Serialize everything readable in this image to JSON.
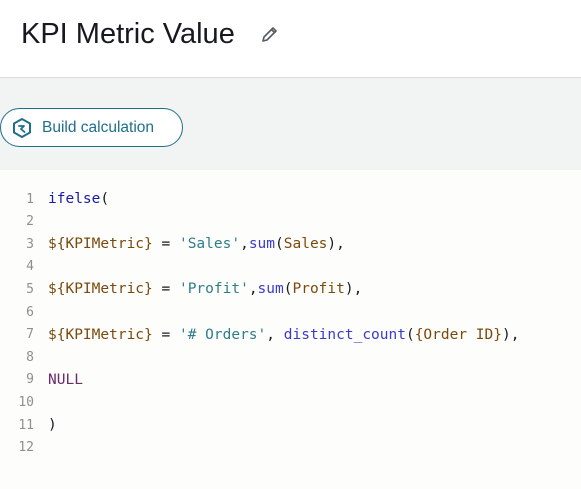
{
  "header": {
    "title": "KPI Metric Value",
    "edit_icon": "pencil-icon"
  },
  "toolbar": {
    "build_label": "Build calculation",
    "build_icon": "calculation-icon"
  },
  "editor": {
    "lines": [
      {
        "num": "1",
        "tokens": [
          {
            "t": "ifelse",
            "c": "kw"
          },
          {
            "t": "(",
            "c": "op"
          }
        ]
      },
      {
        "num": "2",
        "tokens": []
      },
      {
        "num": "3",
        "tokens": [
          {
            "t": "${KPIMetric}",
            "c": "field"
          },
          {
            "t": " = ",
            "c": "op"
          },
          {
            "t": "'Sales'",
            "c": "str"
          },
          {
            "t": ",",
            "c": "op"
          },
          {
            "t": "sum",
            "c": "fn"
          },
          {
            "t": "(",
            "c": "op"
          },
          {
            "t": "Sales",
            "c": "field"
          },
          {
            "t": "),",
            "c": "op"
          }
        ]
      },
      {
        "num": "4",
        "tokens": []
      },
      {
        "num": "5",
        "tokens": [
          {
            "t": "${KPIMetric}",
            "c": "field"
          },
          {
            "t": " = ",
            "c": "op"
          },
          {
            "t": "'Profit'",
            "c": "str"
          },
          {
            "t": ",",
            "c": "op"
          },
          {
            "t": "sum",
            "c": "fn"
          },
          {
            "t": "(",
            "c": "op"
          },
          {
            "t": "Profit",
            "c": "field"
          },
          {
            "t": "),",
            "c": "op"
          }
        ]
      },
      {
        "num": "6",
        "tokens": []
      },
      {
        "num": "7",
        "tokens": [
          {
            "t": "${KPIMetric}",
            "c": "field"
          },
          {
            "t": " = ",
            "c": "op"
          },
          {
            "t": "'# Orders'",
            "c": "str"
          },
          {
            "t": ", ",
            "c": "op"
          },
          {
            "t": "distinct_count",
            "c": "fn"
          },
          {
            "t": "(",
            "c": "op"
          },
          {
            "t": "{Order ID}",
            "c": "field"
          },
          {
            "t": "),",
            "c": "op"
          }
        ]
      },
      {
        "num": "8",
        "tokens": []
      },
      {
        "num": "9",
        "tokens": [
          {
            "t": "NULL",
            "c": "null"
          }
        ]
      },
      {
        "num": "10",
        "tokens": []
      },
      {
        "num": "11",
        "tokens": [
          {
            "t": ")",
            "c": "op"
          }
        ]
      },
      {
        "num": "12",
        "tokens": []
      }
    ]
  }
}
